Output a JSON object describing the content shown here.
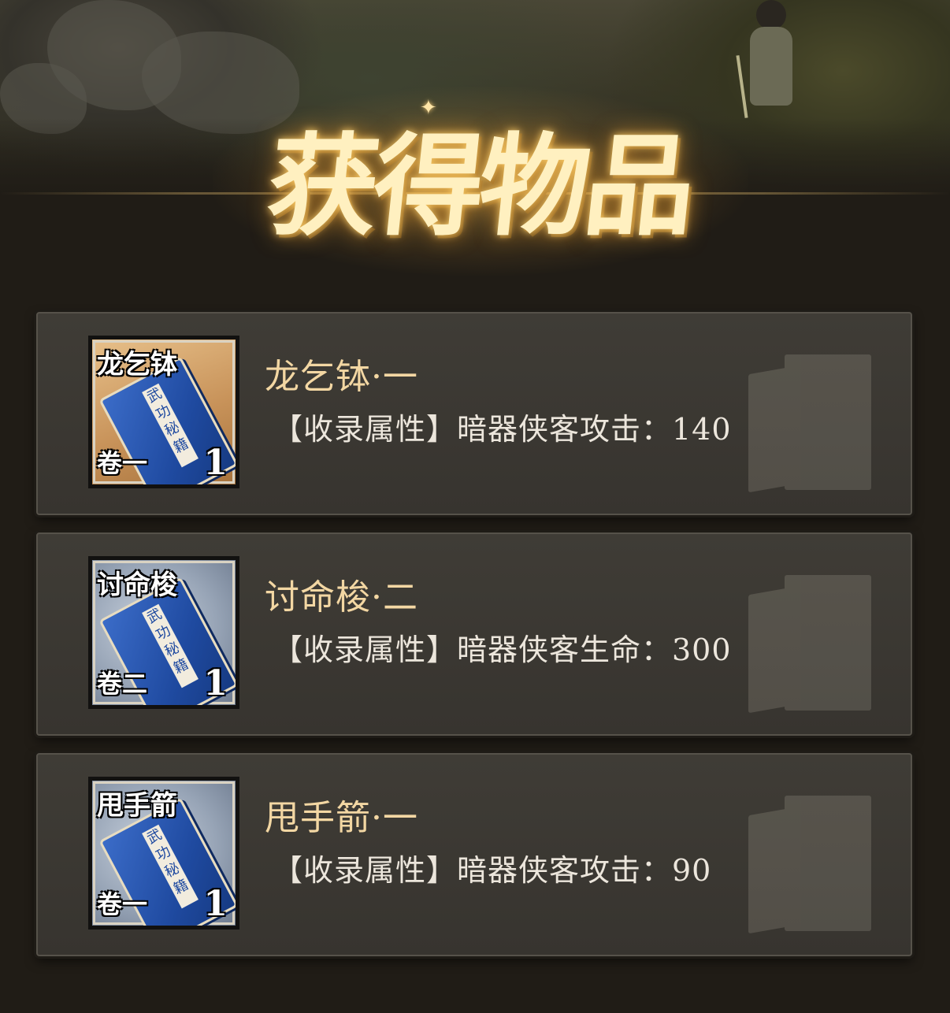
{
  "header": {
    "title": "获得物品"
  },
  "items": [
    {
      "icon_name": "龙乞钵",
      "icon_volume": "卷一",
      "icon_count": "1",
      "book_label": "武功秘籍",
      "rarity_color": "#c8935a",
      "title": "龙乞钵·一",
      "attribute": "【收录属性】暗器侠客攻击：140"
    },
    {
      "icon_name": "讨命梭",
      "icon_volume": "卷二",
      "icon_count": "1",
      "book_label": "武功秘籍",
      "rarity_color": "#97a4b6",
      "title": "讨命梭·二",
      "attribute": "【收录属性】暗器侠客生命：300"
    },
    {
      "icon_name": "甩手箭",
      "icon_volume": "卷一",
      "icon_count": "1",
      "book_label": "武功秘籍",
      "rarity_color": "#97a4b6",
      "title": "甩手箭·一",
      "attribute": "【收录属性】暗器侠客攻击：90"
    }
  ]
}
